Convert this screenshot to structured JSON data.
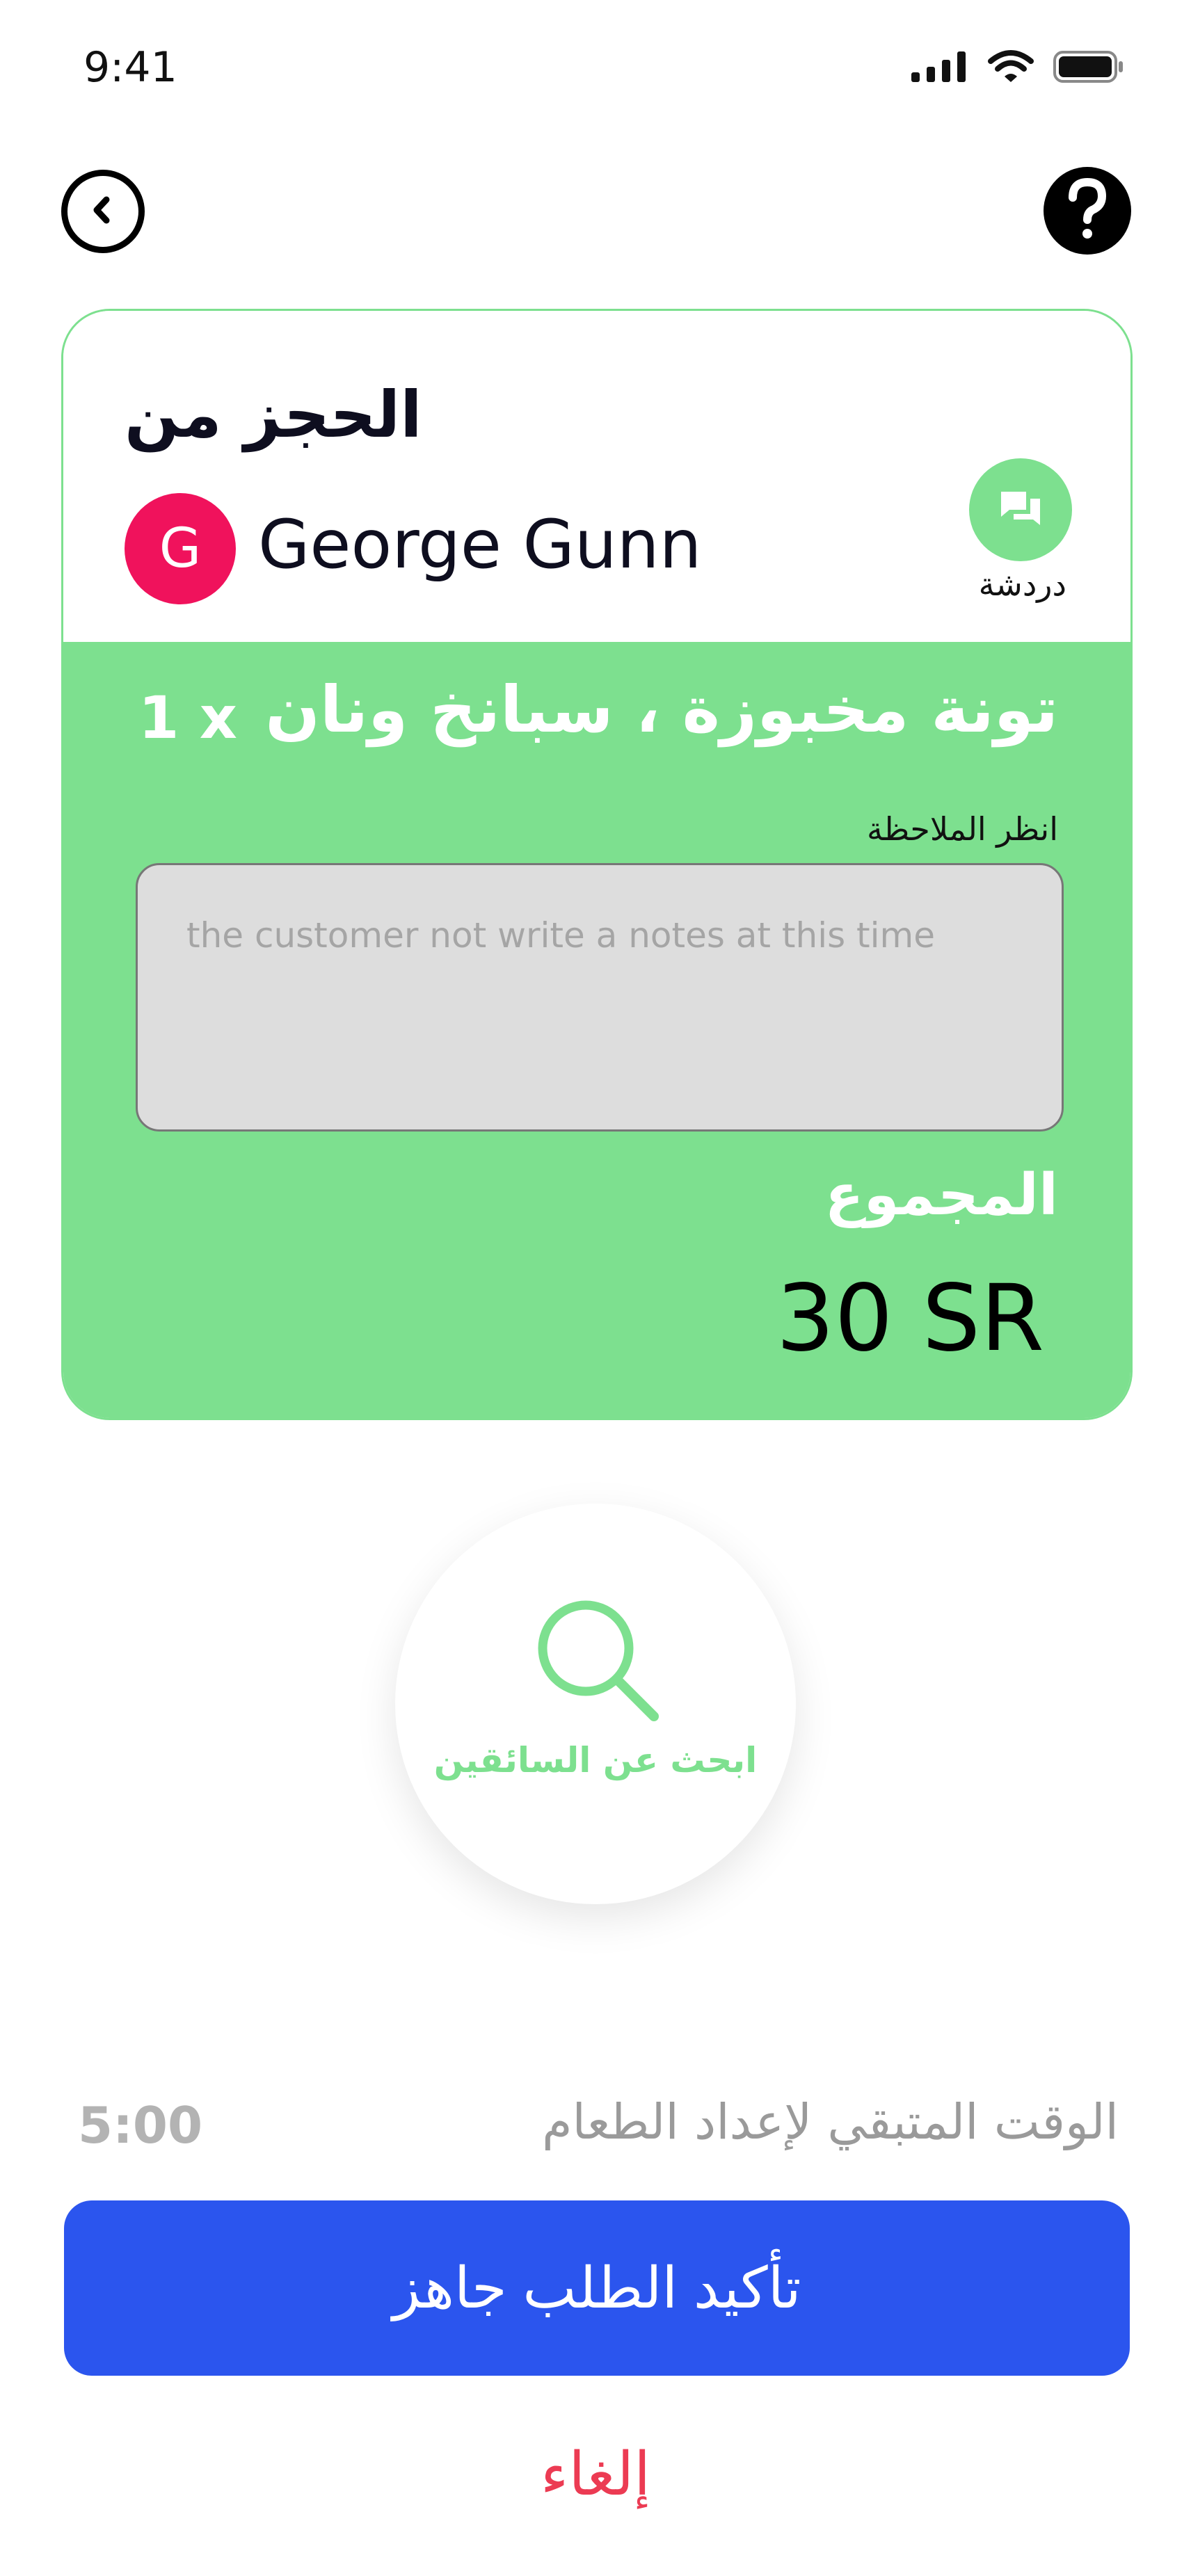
{
  "status_bar": {
    "time": "9:41",
    "icons": [
      "signal-icon",
      "wifi-icon",
      "battery-icon"
    ]
  },
  "nav": {
    "back_icon": "chevron-left-icon",
    "help_icon": "question-mark-icon"
  },
  "booking": {
    "title": "الحجز من",
    "customer": {
      "initial": "G",
      "name": "George Gunn",
      "avatar_color": "#f0125c"
    },
    "chat": {
      "icon": "chat-bubbles-icon",
      "label": "دردشة"
    },
    "item": {
      "name": "تونة مخبوزة ، سبانخ ونان",
      "quantity": "1 x"
    },
    "notes": {
      "label": "انظر الملاحظة",
      "text": "the customer not write a notes at this time"
    },
    "total": {
      "label": "المجموع",
      "value": "30 SR"
    }
  },
  "search_drivers": {
    "icon": "search-icon",
    "label": "ابحث عن السائقين"
  },
  "prep": {
    "label": "الوقت المتبقي لإعداد الطعام",
    "time": "5:00"
  },
  "actions": {
    "confirm_label": "تأكيد الطلب جاهز",
    "cancel_label": "إلغاء"
  },
  "colors": {
    "accent_green": "#7de08f",
    "primary_blue": "#2b55ee",
    "danger_red": "#ec3b53"
  }
}
